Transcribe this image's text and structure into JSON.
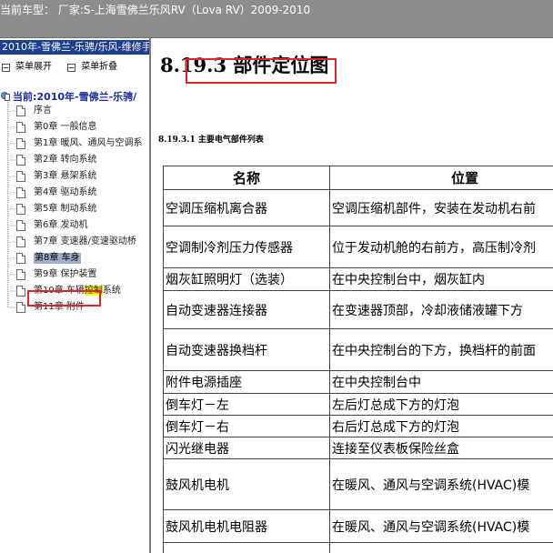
{
  "window": {
    "title": "当前车型：  厂家:S-上海雪佛兰乐风RV（Lova RV）2009-2010"
  },
  "sidebar": {
    "header": "2010年-雪佛兰-乐骋/乐风-维修手",
    "tools": {
      "expand": "菜单展开",
      "collapse": "菜单折叠"
    },
    "root_label": "当前:2010年-雪佛兰-乐骋/",
    "items": [
      {
        "label": "序言"
      },
      {
        "label": "第0章 一般信息"
      },
      {
        "label": "第1章 暖风、通风与空调系"
      },
      {
        "label": "第2章 转向系统"
      },
      {
        "label": "第3章 悬架系统"
      },
      {
        "label": "第4章 驱动系统"
      },
      {
        "label": "第5章 制动系统"
      },
      {
        "label": "第6章 发动机"
      },
      {
        "label": "第7章 变速器/变速驱动桥"
      },
      {
        "label": "第8章 车身",
        "selected": true
      },
      {
        "label": "第9章 保护装置"
      },
      {
        "label_pre": "第10章 车辆",
        "label_hl": "控制",
        "label_post": "系统"
      },
      {
        "label": "第11章 附件"
      }
    ]
  },
  "content": {
    "heading": "8.19.3 部件定位图",
    "subheading": "8.19.3.1 主要电气部件列表",
    "table": {
      "headers": [
        "名称",
        "位置"
      ],
      "rows": [
        [
          "空调压缩机离合器",
          "空调压缩机部件，安装在发动机右前"
        ],
        [
          "空调制冷剂压力传感器",
          "位于发动机舱的右前方，高压制冷剂"
        ],
        [
          "烟灰缸照明灯（选装）",
          "在中央控制台中，烟灰缸内"
        ],
        [
          "自动变速器连接器",
          "在变速器顶部，冷却液储液罐下方"
        ],
        [
          "自动变速器换档杆",
          "在中央控制台的下方，换档杆的前面"
        ],
        [
          "附件电源插座",
          "在中央控制台中"
        ],
        [
          "倒车灯－左",
          "左后灯总成下方的灯泡"
        ],
        [
          "倒车灯－右",
          "右后灯总成下方的灯泡"
        ],
        [
          "闪光继电器",
          "连接至仪表板保险丝盒"
        ],
        [
          "鼓风机电机",
          "在暖风、通风与空调系统(HVAC)模"
        ],
        [
          "鼓风机电机电阻器",
          "在暖风、通风与空调系统(HVAC)模"
        ],
        [
          "",
          ""
        ]
      ]
    }
  },
  "colors": {
    "titlebar": "#8d8d8d",
    "sidebar_header": "#1d3f8f",
    "annotation_red": "#e0242c",
    "selection": "#9db0c7",
    "highlight": "#ffff00"
  }
}
